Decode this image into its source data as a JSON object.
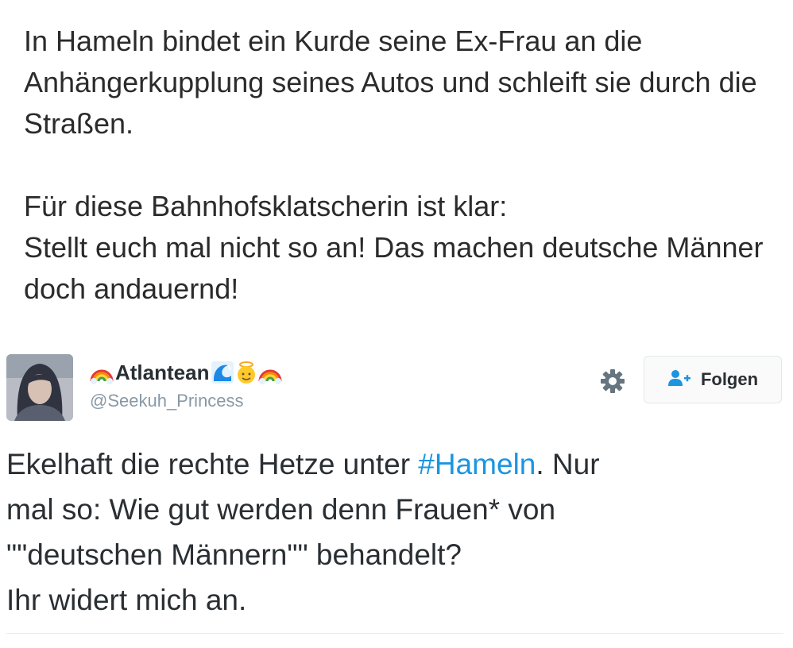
{
  "caption": {
    "paragraph1": "In Hameln bindet ein Kurde seine Ex-Frau an die Anhängerkupplung seines Autos und schleift sie durch die Straßen.",
    "paragraph2_line1": "Für diese Bahnhofsklatscherin ist klar:",
    "paragraph2_line2": "Stellt euch mal nicht so an! Das machen deutsche Männer doch andauernd!"
  },
  "tweet": {
    "display_name": "Atlantean",
    "handle": "@Seekuh_Princess",
    "name_emojis": [
      "rainbow-icon",
      "wave-icon",
      "angel-icon",
      "rainbow-icon"
    ],
    "follow_label": "Folgen",
    "text_line1_before": "Ekelhaft die rechte Hetze unter ",
    "hashtag": "#Hameln",
    "text_line1_after": ". Nur",
    "text_line2": "mal so: Wie gut werden denn Frauen* von",
    "text_line3": "\"\"deutschen Männern\"\" behandelt?",
    "text_line4": "Ihr widert mich an."
  },
  "colors": {
    "caption_text": "#2b2b2b",
    "tweet_text": "#292f33",
    "hashtag": "#1b95e0",
    "handle": "#8899a6"
  }
}
